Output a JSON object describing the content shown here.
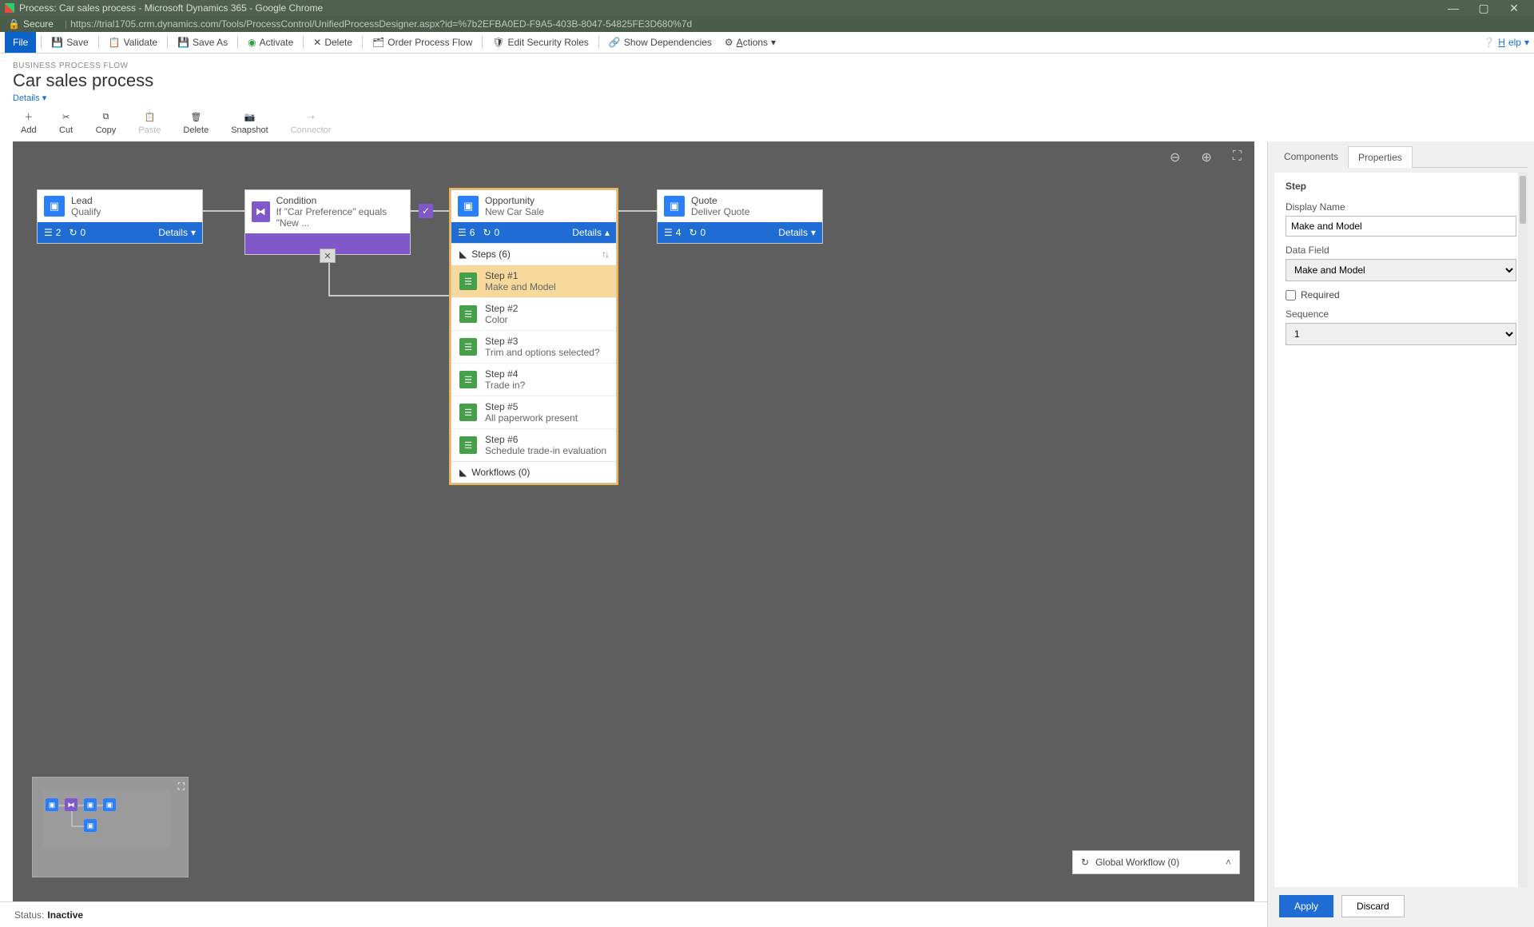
{
  "window": {
    "title": "Process: Car sales process - Microsoft Dynamics 365 - Google Chrome"
  },
  "address": {
    "secure_label": "Secure",
    "url": "https://trial1705.crm.dynamics.com/Tools/ProcessControl/UnifiedProcessDesigner.aspx?id=%7b2EFBA0ED-F9A5-403B-8047-54825FE3D680%7d"
  },
  "toolbar": {
    "file": "File",
    "save": "Save",
    "validate": "Validate",
    "save_as": "Save As",
    "activate": "Activate",
    "delete": "Delete",
    "order": "Order Process Flow",
    "security": "Edit Security Roles",
    "dependencies": "Show Dependencies",
    "actions": "Actions",
    "help": "Help"
  },
  "header": {
    "eyebrow": "BUSINESS PROCESS FLOW",
    "title": "Car sales process",
    "details": "Details"
  },
  "actions": {
    "add": "Add",
    "cut": "Cut",
    "copy": "Copy",
    "paste": "Paste",
    "delete": "Delete",
    "snapshot": "Snapshot",
    "connector": "Connector"
  },
  "stages": {
    "lead": {
      "name": "Lead",
      "sub": "Qualify",
      "steps": "2",
      "workflows": "0",
      "details": "Details"
    },
    "condition": {
      "name": "Condition",
      "sub": "If \"Car Preference\" equals \"New ..."
    },
    "opp": {
      "name": "Opportunity",
      "sub": "New Car Sale",
      "steps": "6",
      "workflows": "0",
      "details": "Details",
      "steps_header": "Steps (6)",
      "steps_list": [
        {
          "num": "Step #1",
          "label": "Make and Model"
        },
        {
          "num": "Step #2",
          "label": "Color"
        },
        {
          "num": "Step #3",
          "label": "Trim and options selected?"
        },
        {
          "num": "Step #4",
          "label": "Trade in?"
        },
        {
          "num": "Step #5",
          "label": "All paperwork present"
        },
        {
          "num": "Step #6",
          "label": "Schedule trade-in evaluation"
        }
      ],
      "workflows_header": "Workflows (0)"
    },
    "quote": {
      "name": "Quote",
      "sub": "Deliver Quote",
      "steps": "4",
      "workflows": "0",
      "details": "Details"
    }
  },
  "global_workflow": "Global Workflow (0)",
  "side": {
    "tab_components": "Components",
    "tab_properties": "Properties",
    "section": "Step",
    "display_name_label": "Display Name",
    "display_name_value": "Make and Model",
    "data_field_label": "Data Field",
    "data_field_value": "Make and Model",
    "required_label": "Required",
    "sequence_label": "Sequence",
    "sequence_value": "1",
    "apply": "Apply",
    "discard": "Discard"
  },
  "status": {
    "label": "Status:",
    "value": "Inactive"
  }
}
